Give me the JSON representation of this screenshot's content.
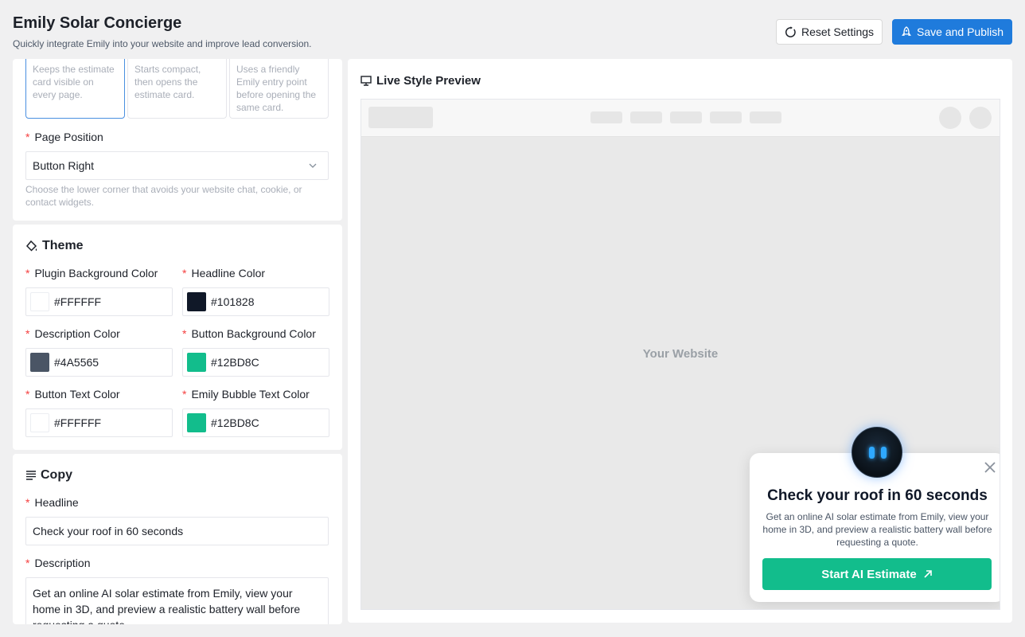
{
  "header": {
    "title": "Emily Solar Concierge",
    "subtitle": "Quickly integrate Emily into your website and improve lead conversion.",
    "reset_label": "Reset Settings",
    "save_label": "Save and Publish"
  },
  "display_modes": [
    {
      "description": "Keeps the estimate card visible on every page.",
      "selected": true
    },
    {
      "description": "Starts compact, then opens the estimate card.",
      "selected": false
    },
    {
      "description": "Uses a friendly Emily entry point before opening the same card.",
      "selected": false
    }
  ],
  "page_position": {
    "label": "Page Position",
    "value": "Button Right",
    "help": "Choose the lower corner that avoids your website chat, cookie, or contact widgets."
  },
  "theme": {
    "title": "Theme",
    "fields": [
      {
        "label": "Plugin Background Color",
        "value": "#FFFFFF",
        "swatch": "#FFFFFF"
      },
      {
        "label": "Headline Color",
        "value": "#101828",
        "swatch": "#101828"
      },
      {
        "label": "Description Color",
        "value": "#4A5565",
        "swatch": "#4A5565"
      },
      {
        "label": "Button Background Color",
        "value": "#12BD8C",
        "swatch": "#12BD8C"
      },
      {
        "label": "Button Text Color",
        "value": "#FFFFFF",
        "swatch": "#FFFFFF"
      },
      {
        "label": "Emily Bubble Text Color",
        "value": "#12BD8C",
        "swatch": "#12BD8C"
      }
    ]
  },
  "copy": {
    "title": "Copy",
    "headline_label": "Headline",
    "headline_value": "Check your roof in 60 seconds",
    "description_label": "Description",
    "description_value": "Get an online AI solar estimate from Emily, view your home in 3D, and preview a realistic battery wall before requesting a quote."
  },
  "preview": {
    "title": "Live Style Preview",
    "site_placeholder": "Your Website",
    "widget_headline": "Check your roof in 60 seconds",
    "widget_description": "Get an online AI solar estimate from Emily, view your home in 3D, and preview a realistic battery wall before requesting a quote.",
    "widget_button": "Start AI Estimate"
  },
  "colors": {
    "primary": "#1F7BDC",
    "accent": "#12BD8C",
    "required": "#F53F3F"
  }
}
